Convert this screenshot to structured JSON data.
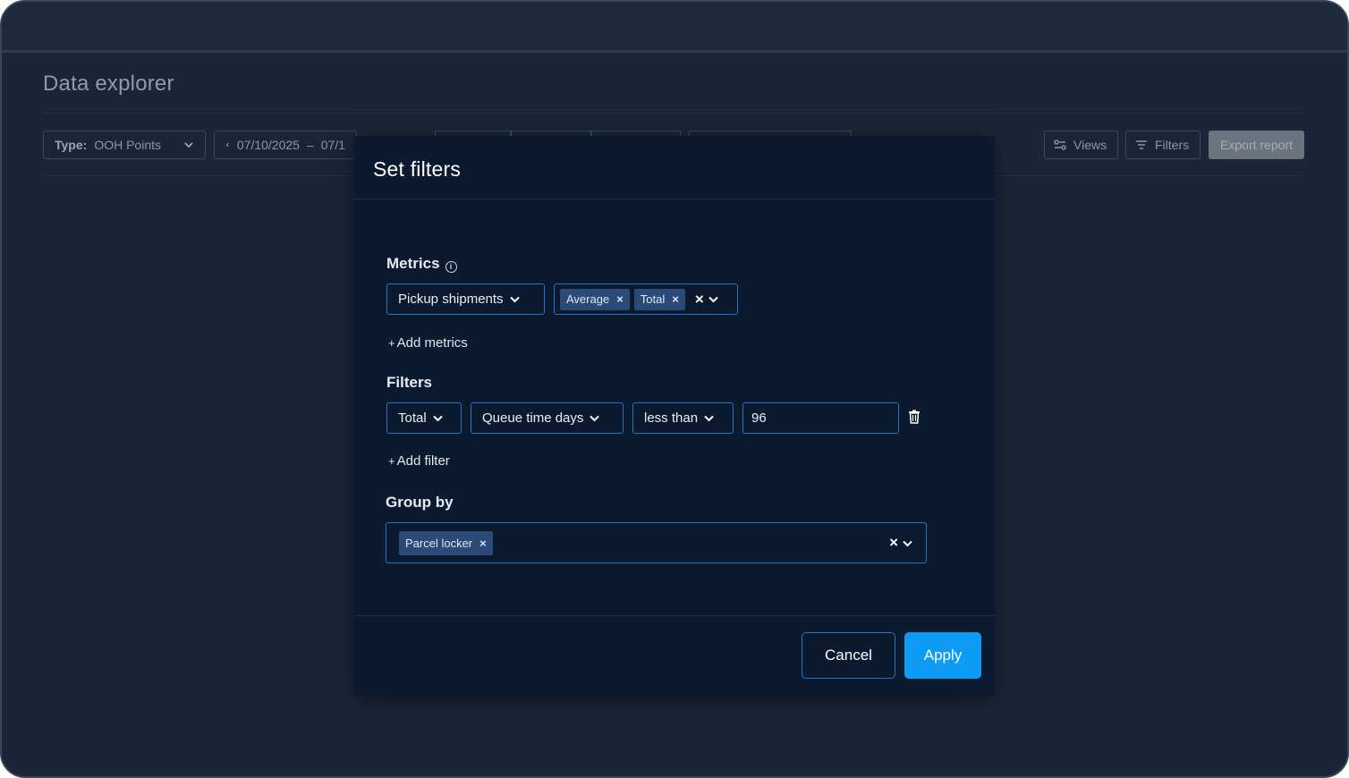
{
  "page": {
    "title": "Data explorer"
  },
  "toolbar": {
    "type_label": "Type:",
    "type_value": "OOH Points",
    "date_start": "07/10/2025",
    "date_separator": "–",
    "date_end_partial": "07/1",
    "views_label": "Views",
    "filters_label": "Filters",
    "export_label": "Export report"
  },
  "modal": {
    "title": "Set filters",
    "metrics": {
      "label": "Metrics",
      "metric_select": "Pickup shipments",
      "aggregations": [
        "Average",
        "Total"
      ],
      "add_label": "Add metrics"
    },
    "filters": {
      "label": "Filters",
      "aggregation": "Total",
      "field": "Queue time days",
      "operator": "less than",
      "value": "96",
      "add_label": "Add filter"
    },
    "group_by": {
      "label": "Group by",
      "chips": [
        "Parcel locker"
      ]
    },
    "cancel_label": "Cancel",
    "apply_label": "Apply"
  },
  "colors": {
    "background": "#1a2638",
    "modal": "#0b1a2e",
    "accent_border": "#2a73c2",
    "chip": "#2a4a78",
    "primary": "#0d9bf5"
  }
}
